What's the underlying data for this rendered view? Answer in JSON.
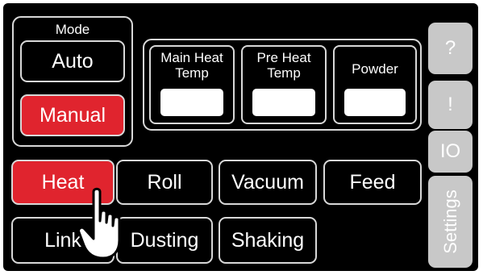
{
  "mode": {
    "title": "Mode",
    "auto_label": "Auto",
    "manual_label": "Manual",
    "selected": "Manual"
  },
  "readouts": [
    {
      "label": "Main Heat Temp",
      "value": ""
    },
    {
      "label": "Pre Heat Temp",
      "value": ""
    },
    {
      "label": "Powder",
      "value": ""
    }
  ],
  "side_buttons": {
    "help_label": "?",
    "alert_label": "!",
    "io_label": "IO",
    "settings_label": "Settings"
  },
  "function_buttons": {
    "heat": "Heat",
    "roll": "Roll",
    "vacuum": "Vacuum",
    "feed": "Feed",
    "link": "Link",
    "dusting": "Dusting",
    "shaking": "Shaking",
    "active": "Heat"
  },
  "colors": {
    "active": "#e0242e",
    "background": "#000000",
    "border": "#d8d8d8",
    "side_button": "#c8c8c8"
  },
  "cursor_icon": "hand-pointer-icon"
}
